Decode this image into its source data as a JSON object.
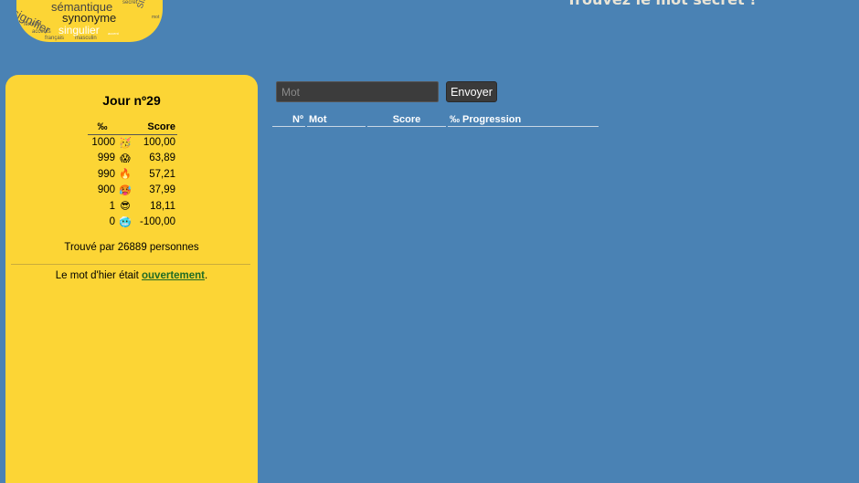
{
  "logo": {
    "words": {
      "semantique": "sémantique",
      "synonyme": "synonyme",
      "signifier": "signifier",
      "singulier": "singulier",
      "similaire": "similaire",
      "secret": "secret",
      "mot": "mot",
      "feminin": "féminin",
      "accents": "accents",
      "francais": "français",
      "masculin": "masculin",
      "accent_small": "accent"
    }
  },
  "header": {
    "headline": "Trouvez le mot secret !"
  },
  "panel": {
    "day_title": "Jour nº29",
    "legend": {
      "col_permille": "‰",
      "col_score": "Score",
      "rows": [
        {
          "permille": "1000",
          "emoji": "🥳",
          "icon": "party-face-icon",
          "score": "100,00"
        },
        {
          "permille": "999",
          "emoji": "😱",
          "icon": "screaming-face-icon",
          "score": "63,89"
        },
        {
          "permille": "990",
          "emoji": "🔥",
          "icon": "fire-icon",
          "score": "57,21"
        },
        {
          "permille": "900",
          "emoji": "🥵",
          "icon": "hot-face-icon",
          "score": "37,99"
        },
        {
          "permille": "1",
          "emoji": "😎",
          "icon": "sunglasses-face-icon",
          "score": "18,11"
        },
        {
          "permille": "0",
          "emoji": "🥶",
          "icon": "cold-face-icon",
          "score": "-100,00"
        }
      ]
    },
    "found_by": "Trouvé par 26889 personnes",
    "yesterday_prefix": "Le mot d'hier était ",
    "yesterday_word": "ouvertement",
    "yesterday_suffix": "."
  },
  "guess": {
    "placeholder": "Mot",
    "value": "",
    "submit_label": "Envoyer"
  },
  "results": {
    "headers": {
      "number": "Nº",
      "word": "Mot",
      "score": "Score",
      "progression": "‰ Progression"
    },
    "rows": []
  },
  "colors": {
    "background": "#4a82b4",
    "panel": "#fcd535",
    "link": "#1f6b24"
  }
}
